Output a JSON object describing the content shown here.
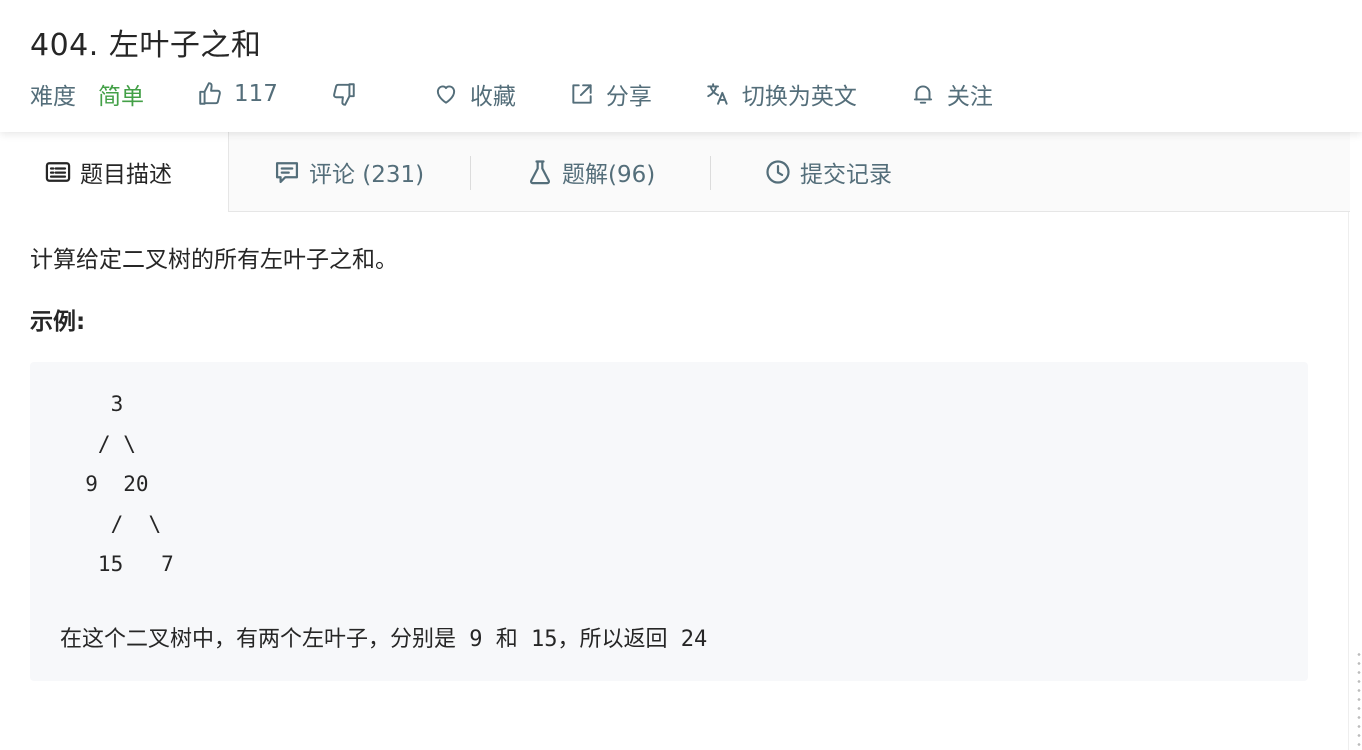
{
  "problem": {
    "title": "404. 左叶子之和",
    "difficulty_label": "难度",
    "difficulty_value": "简单",
    "difficulty_color": "#43a047",
    "likes": "117",
    "favorite_label": "收藏",
    "share_label": "分享",
    "translate_label": "切换为英文",
    "follow_label": "关注"
  },
  "tabs": [
    {
      "label": "题目描述",
      "icon": "description-icon",
      "active": true
    },
    {
      "label": "评论 (231)",
      "icon": "comment-icon",
      "active": false
    },
    {
      "label": "题解(96)",
      "icon": "flask-icon",
      "active": false
    },
    {
      "label": "提交记录",
      "icon": "clock-icon",
      "active": false
    }
  ],
  "content": {
    "description": "计算给定二叉树的所有左叶子之和。",
    "example_label": "示例:",
    "example_tree": "    3\n   / \\\n  9  20\n    /  \\\n   15   7",
    "explanation": "在这个二叉树中，有两个左叶子，分别是 9 和 15，所以返回 24"
  }
}
